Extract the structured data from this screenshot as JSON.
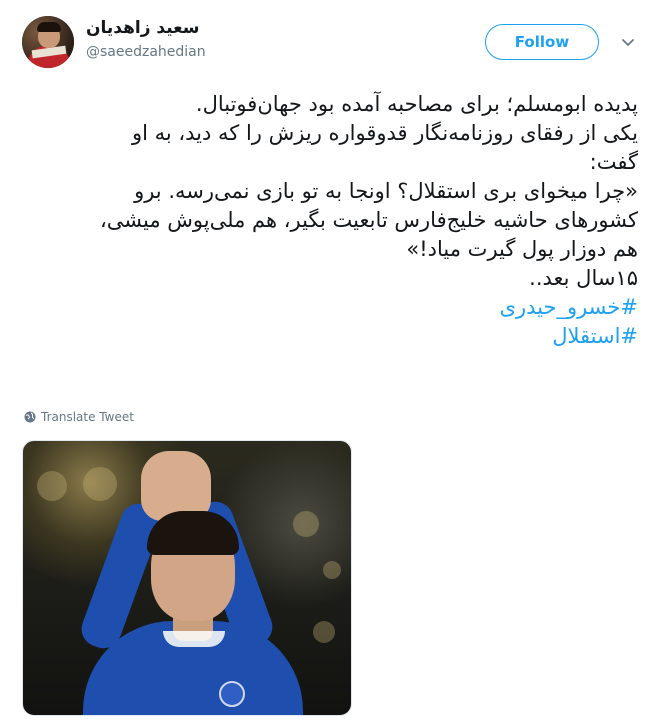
{
  "user": {
    "display_name": "سعید زاهدیان",
    "handle": "@saeedzahedian"
  },
  "follow_label": "Follow",
  "tweet": {
    "lines": [
      "پدیده ابومسلم؛ برای مصاحبه آمده بود جهان‌فوتبال.",
      "یکی از رفقای روزنامه‌نگار قدوقواره ریزش را که دید، به او",
      "گفت:",
      "«چرا میخوای بری استقلال؟ اونجا به تو بازی نمی‌رسه. برو",
      "کشورهای حاشیه خلیج‌فارس تابعیت بگیر، هم ملی‌پوش میشی،",
      "هم دوزار پول گیرت میاد!»",
      "۱۵سال بعد.."
    ],
    "hashtags": [
      "#خسرو_حیدری",
      "#استقلال"
    ]
  },
  "translate_label": "Translate Tweet",
  "colors": {
    "accent": "#1da1f2",
    "secondary_text": "#657786",
    "jersey": "#1f4fae"
  },
  "icons": {
    "menu": "chevron-down-icon",
    "translate": "globe-icon"
  }
}
